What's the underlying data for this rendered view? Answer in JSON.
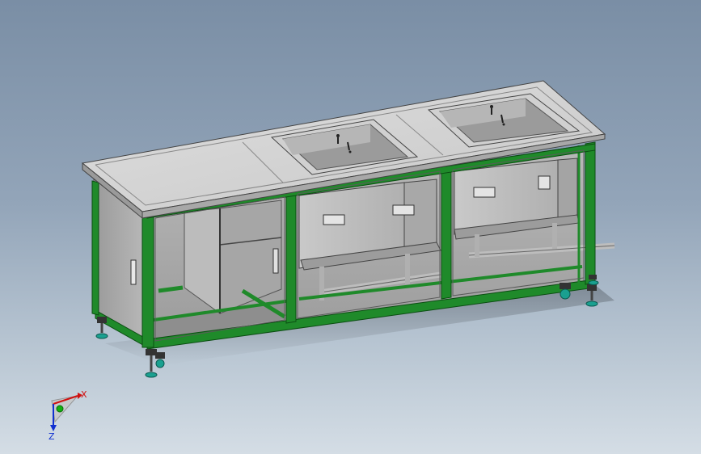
{
  "viewport": {
    "background_top": "#7a8ea5",
    "background_bottom": "#d4dde5"
  },
  "model": {
    "frame_color": "#1f8a2a",
    "sheet_metal_color": "#c4c4c4",
    "tank_count": 2,
    "faucet_count": 2
  },
  "triad": {
    "x_label": "X",
    "y_label": "Y",
    "z_label": "Z",
    "x_color": "#d01010",
    "y_color": "#10b010",
    "z_color": "#1030d0"
  }
}
